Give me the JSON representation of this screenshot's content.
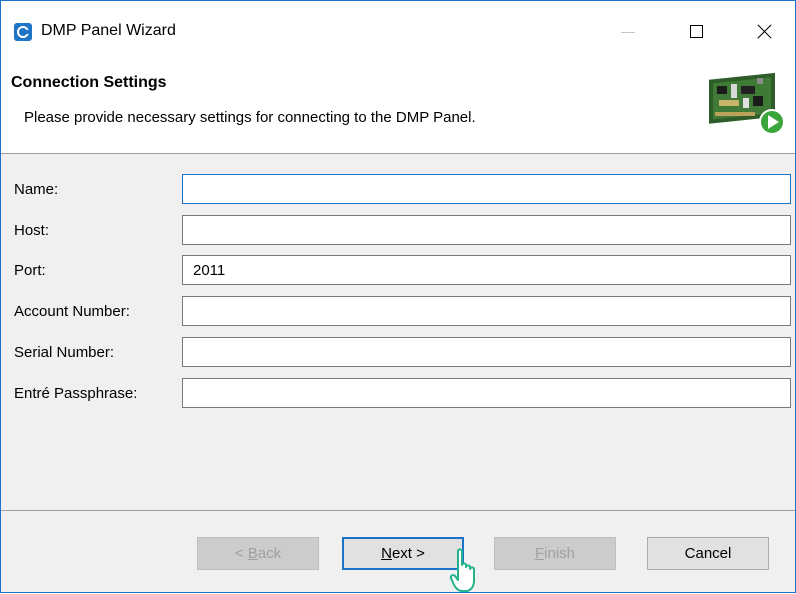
{
  "window": {
    "title": "DMP Panel Wizard"
  },
  "header": {
    "title": "Connection Settings",
    "description": "Please provide necessary settings for connecting to the DMP Panel."
  },
  "form": {
    "fields": [
      {
        "label": "Name:",
        "value": "",
        "focused": true
      },
      {
        "label": "Host:",
        "value": ""
      },
      {
        "label": "Port:",
        "value": "2011"
      },
      {
        "label": "Account Number:",
        "value": ""
      },
      {
        "label": "Serial Number:",
        "value": ""
      },
      {
        "label": "Entré Passphrase:",
        "value": ""
      }
    ]
  },
  "buttons": {
    "back": {
      "prefix": "< ",
      "mnemonic": "B",
      "rest": "ack",
      "enabled": false
    },
    "next": {
      "mnemonic": "N",
      "rest": "ext >",
      "enabled": true
    },
    "finish": {
      "mnemonic": "F",
      "rest": "inish",
      "enabled": false
    },
    "cancel": {
      "label": "Cancel",
      "enabled": true
    }
  },
  "colors": {
    "accent": "#1a73c8",
    "app_icon": "#1e74c6",
    "cursor": "#22b38a"
  },
  "icons": {
    "app": "app-logo-icon",
    "minimize": "minimize-icon",
    "maximize": "maximize-icon",
    "close": "close-icon",
    "panel": "dmp-panel-image",
    "cursor": "hand-pointer-icon"
  }
}
